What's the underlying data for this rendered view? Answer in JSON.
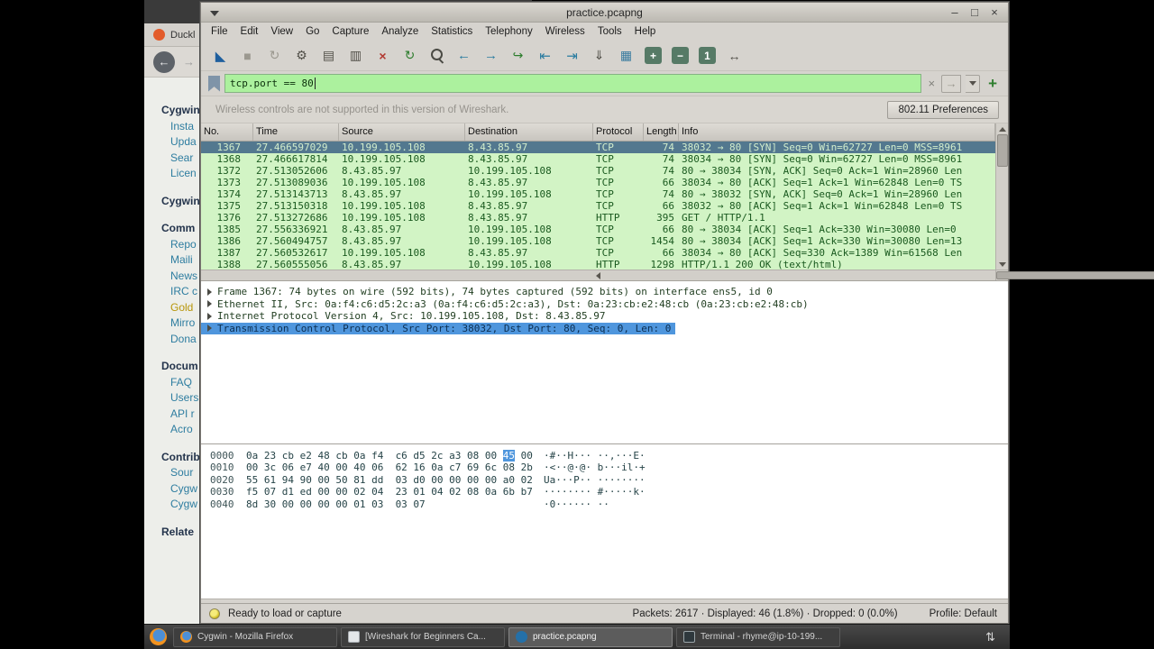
{
  "browser": {
    "tab_title": "Duckl",
    "nav": {
      "back": "←",
      "forward": "→"
    },
    "sidebar": [
      {
        "label": "Cygwin",
        "cls": "header"
      },
      {
        "label": "Insta",
        "cls": "link"
      },
      {
        "label": "Upda",
        "cls": "link"
      },
      {
        "label": "Sear",
        "cls": "link"
      },
      {
        "label": "Licen",
        "cls": "link"
      },
      {
        "label": "Cygwin",
        "cls": "header"
      },
      {
        "label": "Comm",
        "cls": "header"
      },
      {
        "label": "Repo",
        "cls": "link"
      },
      {
        "label": "Maili",
        "cls": "link"
      },
      {
        "label": "News",
        "cls": "link"
      },
      {
        "label": "IRC c",
        "cls": "link"
      },
      {
        "label": "Gold",
        "cls": "gold"
      },
      {
        "label": "Mirro",
        "cls": "link"
      },
      {
        "label": "Dona",
        "cls": "link"
      },
      {
        "label": "Docum",
        "cls": "header"
      },
      {
        "label": "FAQ",
        "cls": "link"
      },
      {
        "label": "Users",
        "cls": "link"
      },
      {
        "label": "API r",
        "cls": "link"
      },
      {
        "label": "Acro",
        "cls": "link"
      },
      {
        "label": "Contrib",
        "cls": "header"
      },
      {
        "label": "Sour",
        "cls": "link"
      },
      {
        "label": "Cygw",
        "cls": "link"
      },
      {
        "label": "Cygw",
        "cls": "link"
      },
      {
        "label": "Relate",
        "cls": "header"
      }
    ]
  },
  "wireshark": {
    "title": "practice.pcapng",
    "controls": {
      "minimize": "–",
      "maximize": "□",
      "close": "×"
    },
    "menu": [
      "File",
      "Edit",
      "View",
      "Go",
      "Capture",
      "Analyze",
      "Statistics",
      "Telephony",
      "Wireless",
      "Tools",
      "Help"
    ],
    "toolbar": [
      {
        "name": "start-capture-icon",
        "glyph": "◣",
        "cls": "c-blue"
      },
      {
        "name": "stop-capture-icon",
        "glyph": "■",
        "cls": "c-dim"
      },
      {
        "name": "restart-capture-icon",
        "glyph": "↻",
        "cls": "c-dim"
      },
      {
        "name": "capture-options-icon",
        "glyph": "⚙",
        "cls": "c-dark"
      },
      {
        "name": "open-file-icon",
        "glyph": "▤",
        "cls": "c-dark"
      },
      {
        "name": "save-file-icon",
        "glyph": "▥",
        "cls": "c-dark"
      },
      {
        "name": "close-file-icon",
        "glyph": "×",
        "cls": "c-red"
      },
      {
        "name": "reload-file-icon",
        "glyph": "↻",
        "cls": "c-green"
      },
      {
        "name": "find-packet-icon",
        "glyph": "",
        "cls": "mag"
      },
      {
        "name": "go-back-icon",
        "glyph": "←",
        "cls": "c-teal"
      },
      {
        "name": "go-forward-icon",
        "glyph": "→",
        "cls": "c-teal"
      },
      {
        "name": "go-to-packet-icon",
        "glyph": "↪",
        "cls": "c-green"
      },
      {
        "name": "go-first-icon",
        "glyph": "⇤",
        "cls": "c-teal"
      },
      {
        "name": "go-last-icon",
        "glyph": "⇥",
        "cls": "c-teal"
      },
      {
        "name": "auto-scroll-icon",
        "glyph": "⇓",
        "cls": "c-dark"
      },
      {
        "name": "colorize-icon",
        "glyph": "▦",
        "cls": "c-multi"
      },
      {
        "name": "zoom-in-icon",
        "glyph": "+",
        "cls": "btn-sq"
      },
      {
        "name": "zoom-out-icon",
        "glyph": "−",
        "cls": "btn-sq"
      },
      {
        "name": "zoom-orig-icon",
        "glyph": "1",
        "cls": "btn-sq"
      },
      {
        "name": "resize-columns-icon",
        "glyph": "↔",
        "cls": "c-dark"
      }
    ],
    "filter": {
      "value": "tcp.port == 80",
      "clear": "×",
      "apply": "→",
      "add": "+"
    },
    "notice": {
      "text": "Wireless controls are not supported in this version of Wireshark.",
      "button": "802.11 Preferences"
    },
    "columns": [
      {
        "label": "No.",
        "cls": "no"
      },
      {
        "label": "Time",
        "cls": "time"
      },
      {
        "label": "Source",
        "cls": "src"
      },
      {
        "label": "Destination",
        "cls": "dst"
      },
      {
        "label": "Protocol",
        "cls": "proto"
      },
      {
        "label": "Length",
        "cls": "len"
      },
      {
        "label": "Info",
        "cls": "info"
      }
    ],
    "packets": [
      {
        "no": "1367",
        "time": "27.466597029",
        "src": "10.199.105.108",
        "dst": "8.43.85.97",
        "proto": "TCP",
        "len": "74",
        "info": "38032 → 80 [SYN] Seq=0 Win=62727 Len=0 MSS=8961",
        "selected": true
      },
      {
        "no": "1368",
        "time": "27.466617814",
        "src": "10.199.105.108",
        "dst": "8.43.85.97",
        "proto": "TCP",
        "len": "74",
        "info": "38034 → 80 [SYN] Seq=0 Win=62727 Len=0 MSS=8961"
      },
      {
        "no": "1372",
        "time": "27.513052606",
        "src": "8.43.85.97",
        "dst": "10.199.105.108",
        "proto": "TCP",
        "len": "74",
        "info": "80 → 38034 [SYN, ACK] Seq=0 Ack=1 Win=28960 Len"
      },
      {
        "no": "1373",
        "time": "27.513089036",
        "src": "10.199.105.108",
        "dst": "8.43.85.97",
        "proto": "TCP",
        "len": "66",
        "info": "38034 → 80 [ACK] Seq=1 Ack=1 Win=62848 Len=0 TS"
      },
      {
        "no": "1374",
        "time": "27.513143713",
        "src": "8.43.85.97",
        "dst": "10.199.105.108",
        "proto": "TCP",
        "len": "74",
        "info": "80 → 38032 [SYN, ACK] Seq=0 Ack=1 Win=28960 Len"
      },
      {
        "no": "1375",
        "time": "27.513150318",
        "src": "10.199.105.108",
        "dst": "8.43.85.97",
        "proto": "TCP",
        "len": "66",
        "info": "38032 → 80 [ACK] Seq=1 Ack=1 Win=62848 Len=0 TS"
      },
      {
        "no": "1376",
        "time": "27.513272686",
        "src": "10.199.105.108",
        "dst": "8.43.85.97",
        "proto": "HTTP",
        "len": "395",
        "info": "GET / HTTP/1.1"
      },
      {
        "no": "1385",
        "time": "27.556336921",
        "src": "8.43.85.97",
        "dst": "10.199.105.108",
        "proto": "TCP",
        "len": "66",
        "info": "80 → 38034 [ACK] Seq=1 Ack=330 Win=30080 Len=0"
      },
      {
        "no": "1386",
        "time": "27.560494757",
        "src": "8.43.85.97",
        "dst": "10.199.105.108",
        "proto": "TCP",
        "len": "1454",
        "info": "80 → 38034 [ACK] Seq=1 Ack=330 Win=30080 Len=13"
      },
      {
        "no": "1387",
        "time": "27.560532617",
        "src": "10.199.105.108",
        "dst": "8.43.85.97",
        "proto": "TCP",
        "len": "66",
        "info": "38034 → 80 [ACK] Seq=330 Ack=1389 Win=61568 Len"
      },
      {
        "no": "1388",
        "time": "27.560555056",
        "src": "8.43.85.97",
        "dst": "10.199.105.108",
        "proto": "HTTP",
        "len": "1298",
        "info": "HTTP/1.1 200 OK  (text/html)"
      }
    ],
    "details": [
      {
        "text": "Frame 1367: 74 bytes on wire (592 bits), 74 bytes captured (592 bits) on interface ens5, id 0"
      },
      {
        "text": "Ethernet II, Src: 0a:f4:c6:d5:2c:a3 (0a:f4:c6:d5:2c:a3), Dst: 0a:23:cb:e2:48:cb (0a:23:cb:e2:48:cb)"
      },
      {
        "text": "Internet Protocol Version 4, Src: 10.199.105.108, Dst: 8.43.85.97"
      },
      {
        "text": "Transmission Control Protocol, Src Port: 38032, Dst Port: 80, Seq: 0, Len: 0",
        "selected": true
      }
    ],
    "hex_rows": [
      {
        "off": "0000",
        "h1": "0a 23 cb e2 48 cb 0a f4  c6 d5 2c a3 08 00 ",
        "hl": "45",
        "h2": " 00",
        "ascii": "·#··H··· ··,···E·"
      },
      {
        "off": "0010",
        "h1": "00 3c 06 e7 40 00 40 06  62 16 0a c7 69 6c 08 2b",
        "hl": "",
        "h2": "",
        "ascii": "·<··@·@· b···il·+"
      },
      {
        "off": "0020",
        "h1": "55 61 94 90 00 50 81 dd  03 d0 00 00 00 00 a0 02",
        "hl": "",
        "h2": "",
        "ascii": "Ua···P·· ········"
      },
      {
        "off": "0030",
        "h1": "f5 07 d1 ed 00 00 02 04  23 01 04 02 08 0a 6b b7",
        "hl": "",
        "h2": "",
        "ascii": "········ #·····k·"
      },
      {
        "off": "0040",
        "h1": "8d 30 00 00 00 00 01 03  03 07",
        "hl": "",
        "h2": "",
        "ascii": "·0······ ··"
      }
    ],
    "status": {
      "ready": "Ready to load or capture",
      "stats": "Packets: 2617 · Displayed: 46 (1.8%) · Dropped: 0 (0.0%)",
      "profile": "Profile: Default"
    }
  },
  "taskbar": {
    "tasks": [
      {
        "label": "Cygwin - Mozilla Firefox",
        "cls": "ic-ff"
      },
      {
        "label": "[Wireshark for Beginners Ca...",
        "cls": "ic-pg"
      },
      {
        "label": "practice.pcapng",
        "cls": "ic-ws",
        "selected": true
      },
      {
        "label": "Terminal - rhyme@ip-10-199...",
        "cls": "ic-tm"
      }
    ],
    "tray": "⇅"
  }
}
